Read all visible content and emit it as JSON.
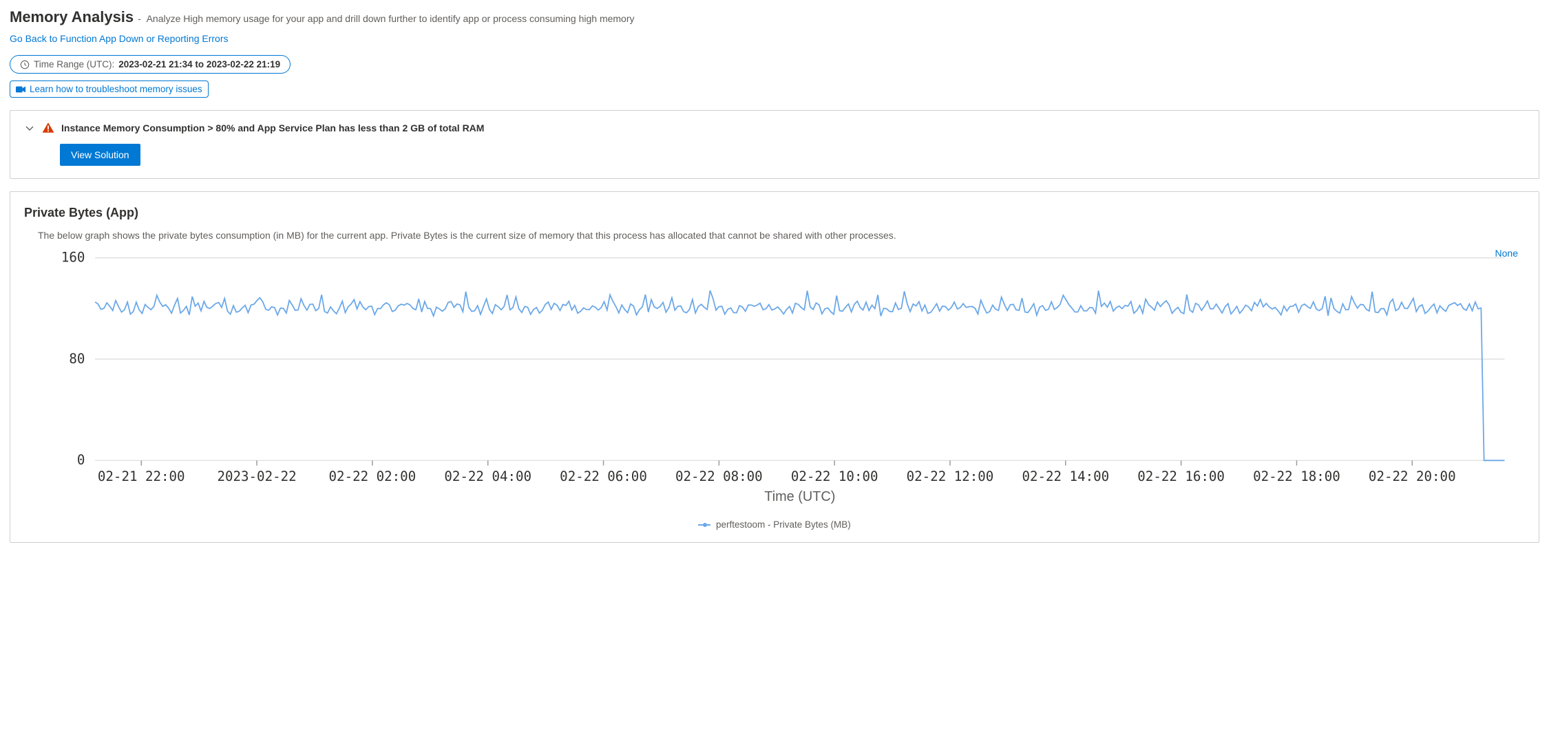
{
  "header": {
    "title": "Memory Analysis",
    "subtitle": "-  Analyze High memory usage for your app and drill down further to identify app or process consuming high memory",
    "back_link": "Go Back to Function App Down or Reporting Errors"
  },
  "timeRange": {
    "label": "Time Range (UTC):",
    "value": "2023-02-21 21:34 to 2023-02-22 21:19"
  },
  "learnLink": "Learn how to troubleshoot memory issues",
  "alert": {
    "text": "Instance Memory Consumption > 80% and App Service Plan has less than 2 GB of total RAM",
    "button": "View Solution"
  },
  "privateBytes": {
    "title": "Private Bytes (App)",
    "desc": "The below graph shows the private bytes consumption (in MB) for the current app. Private Bytes is the current size of memory that this process has allocated that cannot be shared with other processes.",
    "noneLabel": "None",
    "legend": "perftestoom - Private Bytes (MB)",
    "xlabel": "Time (UTC)"
  },
  "chart_data": {
    "type": "line",
    "title": "Private Bytes (App)",
    "xlabel": "Time (UTC)",
    "ylabel": "",
    "ylim": [
      0,
      160
    ],
    "yticks": [
      0,
      80,
      160
    ],
    "xticks": [
      "02-21 22:00",
      "2023-02-22",
      "02-22 02:00",
      "02-22 04:00",
      "02-22 06:00",
      "02-22 08:00",
      "02-22 10:00",
      "02-22 12:00",
      "02-22 14:00",
      "02-22 16:00",
      "02-22 18:00",
      "02-22 20:00"
    ],
    "series": [
      {
        "name": "perftestoom - Private Bytes (MB)",
        "color": "#6aa7e8",
        "approx_baseline": 120,
        "approx_spike_max": 135,
        "drop_at": "02-22 21:00",
        "drop_to": 0,
        "note": "Values oscillate rapidly between ~115 and ~130 MB across the full window, then drop to 0 at the end."
      }
    ]
  }
}
